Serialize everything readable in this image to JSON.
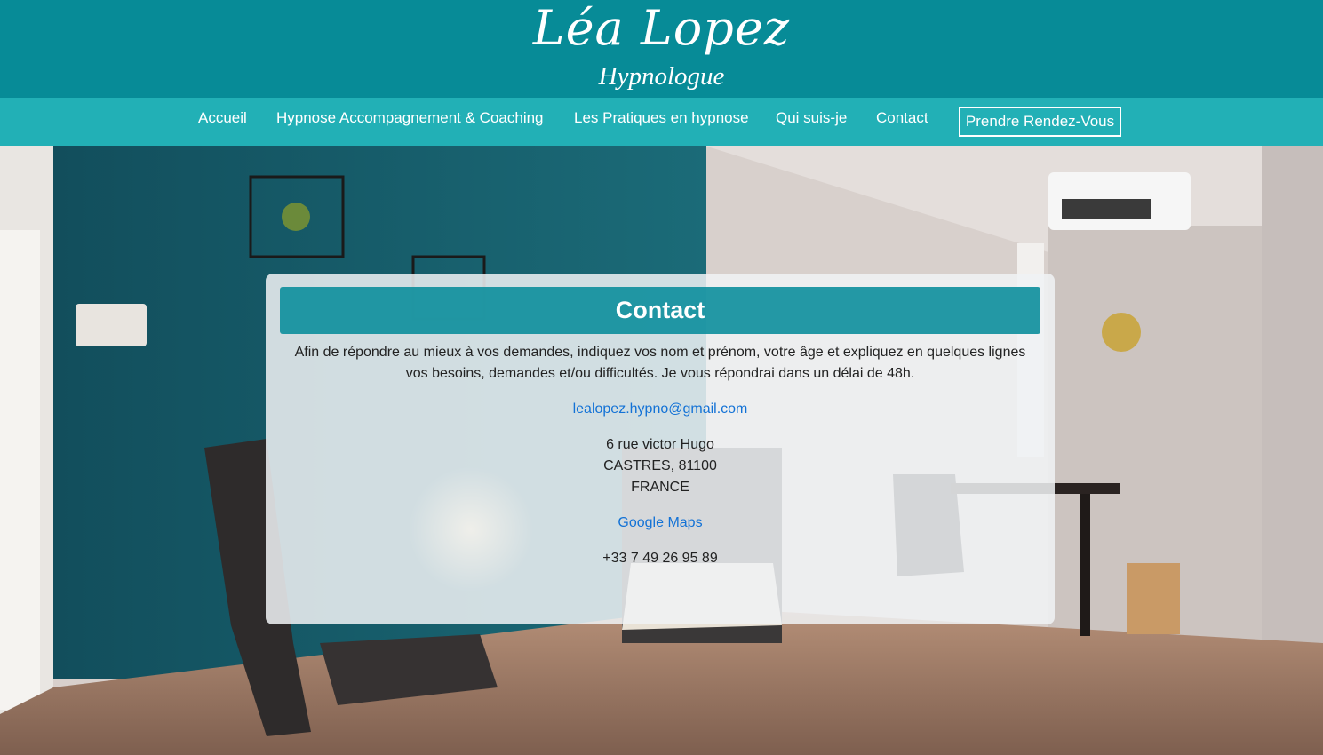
{
  "brand": {
    "name": "Léa Lopez",
    "subtitle": "Hypnologue",
    "colors": {
      "header": "#078b97",
      "nav": "#22b0b6",
      "accent": "#0c8e9c",
      "link": "#1372d6"
    }
  },
  "nav": {
    "items": [
      {
        "label": "Accueil"
      },
      {
        "label": "Hypnose Accompagnement & Coaching"
      },
      {
        "label": "Les Pratiques en hypnose"
      },
      {
        "label": "Qui suis-je"
      },
      {
        "label": "Contact"
      }
    ],
    "cta": "Prendre Rendez-Vous"
  },
  "contact": {
    "title": "Contact",
    "intro_line1": "Afin de répondre au mieux à vos demandes, indiquez vos nom et prénom, votre âge et expliquez en quelques lignes",
    "intro_line2": "vos besoins, demandes et/ou difficultés. Je vous répondrai dans un délai de 48h.",
    "email": "lealopez.hypno@gmail.com",
    "address": [
      "6 rue victor Hugo",
      "CASTRES, 81100",
      "FRANCE"
    ],
    "maps_link": "Google Maps",
    "phone": "+33 7 49 26 95 89"
  }
}
